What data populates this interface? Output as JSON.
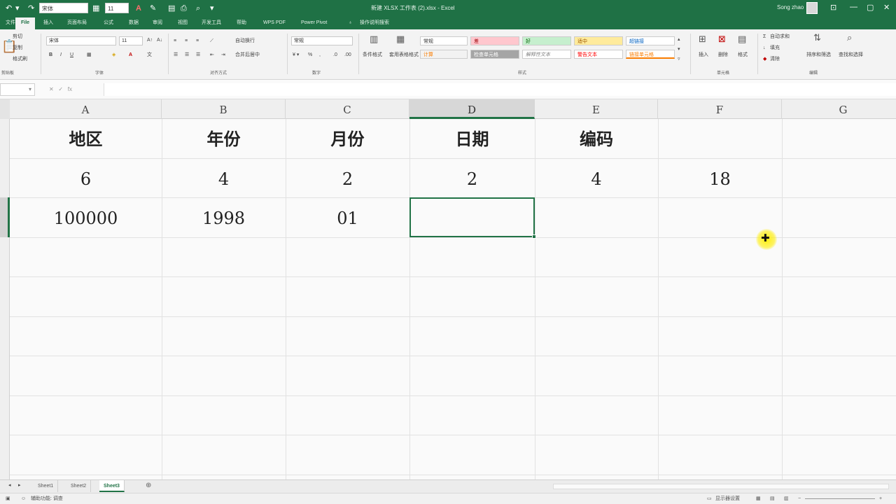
{
  "titlebar": {
    "font_name": "宋体",
    "font_size": "11",
    "title": "新建 XLSX 工作表 (2).xlsx - Excel",
    "user": "Song zhao"
  },
  "tabs": [
    "文件",
    "File",
    "插入",
    "页面布局",
    "公式",
    "数据",
    "审阅",
    "视图",
    "开发工具",
    "帮助",
    "WPS PDF",
    "Power Pivot",
    "操作说明搜索"
  ],
  "ribbon": {
    "clipboard": {
      "cut": "剪切",
      "copy": "复制",
      "format_painter": "格式刷",
      "label": "剪贴板"
    },
    "font": {
      "name": "宋体",
      "size": "11",
      "label": "字体"
    },
    "alignment": {
      "wrap": "自动换行",
      "merge": "合并后居中",
      "label": "对齐方式"
    },
    "number": {
      "format": "常规",
      "label": "数字"
    },
    "styles": {
      "conditional": "条件格式",
      "table": "套用表格格式",
      "cells": [
        {
          "text": "常规",
          "bg": "#ffffff",
          "fg": "#333333"
        },
        {
          "text": "差",
          "bg": "#ffc7ce",
          "fg": "#9c0006"
        },
        {
          "text": "好",
          "bg": "#c6efce",
          "fg": "#006100"
        },
        {
          "text": "适中",
          "bg": "#ffeb9c",
          "fg": "#9c5700"
        },
        {
          "text": "超链接",
          "bg": "#ffffff",
          "fg": "#0563c1"
        },
        {
          "text": "计算",
          "bg": "#f2f2f2",
          "fg": "#fa7d00"
        },
        {
          "text": "检查单元格",
          "bg": "#a5a5a5",
          "fg": "#ffffff"
        },
        {
          "text": "解释性文本",
          "bg": "#ffffff",
          "fg": "#7f7f7f"
        },
        {
          "text": "警告文本",
          "bg": "#ffffff",
          "fg": "#ff0000"
        },
        {
          "text": "链接单元格",
          "bg": "#ffffff",
          "fg": "#fa7d00"
        }
      ],
      "label": "样式"
    },
    "cells_group": {
      "insert": "插入",
      "delete": "删除",
      "format": "格式",
      "label": "单元格"
    },
    "editing": {
      "autosum": "自动求和",
      "fill": "填充",
      "clear": "清除",
      "sort": "排序和筛选",
      "find": "查找和选择",
      "label": "编辑"
    }
  },
  "formula_bar": {
    "fx": "fx"
  },
  "columns": [
    "A",
    "B",
    "C",
    "D",
    "E",
    "F",
    "G"
  ],
  "grid": {
    "row1": [
      "地区",
      "年份",
      "月份",
      "日期",
      "编码",
      "",
      ""
    ],
    "row2": [
      "6",
      "4",
      "2",
      "2",
      "4",
      "18",
      ""
    ],
    "row3": [
      "100000",
      "1998",
      "01",
      "",
      "",
      "",
      ""
    ]
  },
  "sheets": [
    "Sheet1",
    "Sheet2",
    "Sheet3"
  ],
  "status": {
    "mode": "辅助功能: 调查",
    "display": "显示器设置"
  }
}
